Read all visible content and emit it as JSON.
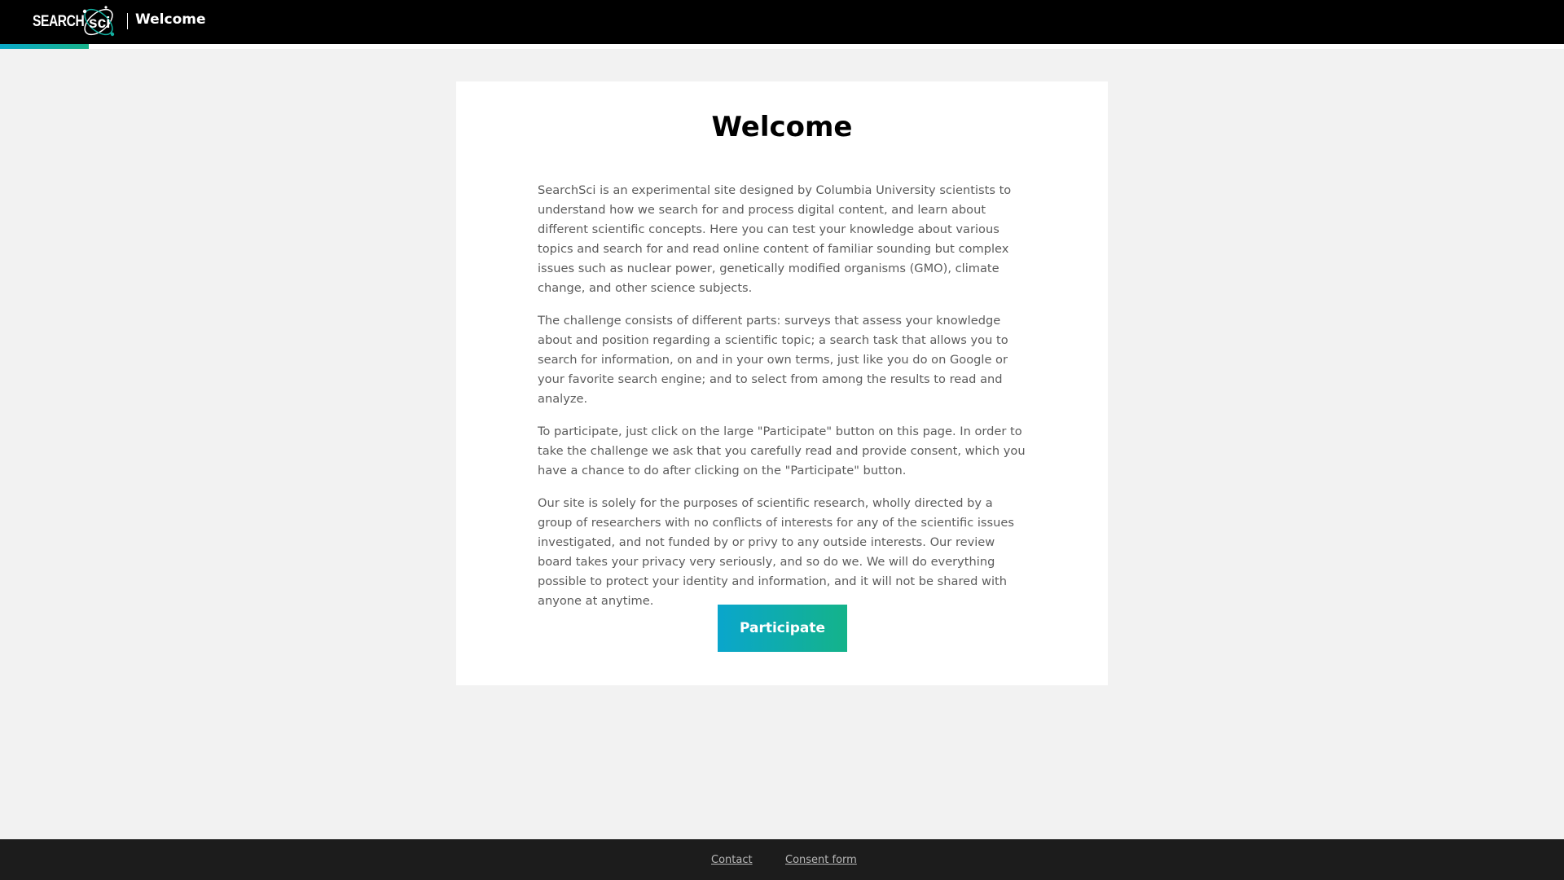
{
  "header": {
    "logo_text": "SEARCH",
    "logo_accent_text": "sci",
    "title": "Welcome"
  },
  "progress": {
    "fraction": 0.057
  },
  "card": {
    "title": "Welcome",
    "paragraphs": [
      "SearchSci is an experimental site designed by Columbia University scientists to understand how we search for and process digital content, and learn about different scientific concepts. Here you can test your knowledge about various topics and search for and read online content of familiar sounding but complex issues such as nuclear power, genetically modified organisms (GMO), climate change, and other science subjects.",
      "The challenge consists of different parts: surveys that assess your knowledge about and position regarding a scientific topic; a search task that allows you to search for information, on and in your own terms, just like you do on Google or your favorite search engine; and to select from among the results to read and analyze.",
      "To participate, just click on the large \"Participate\" button on this page. In order to take the challenge we ask that you carefully read and provide consent, which you have a chance to do after clicking on the \"Participate\" button.",
      "Our site is solely for the purposes of scientific research, wholly directed by a group of researchers with no conflicts of interests for any of the scientific issues investigated, and not funded by or privy to any outside interests. Our review board takes your privacy very seriously, and so do we. We will do everything possible to protect your identity and information, and it will not be shared with anyone at anytime."
    ],
    "participate_label": "Participate"
  },
  "footer": {
    "contact_label": "Contact",
    "consent_label": "Consent form"
  },
  "colors": {
    "header_bg": "#000000",
    "accent_start": "#0aa6cc",
    "accent_end": "#14b38a",
    "footer_bg": "#1c1c1c",
    "page_bg": "#f2f2f2"
  },
  "icons": {
    "logo": "searchsci-atom-logo-icon"
  }
}
